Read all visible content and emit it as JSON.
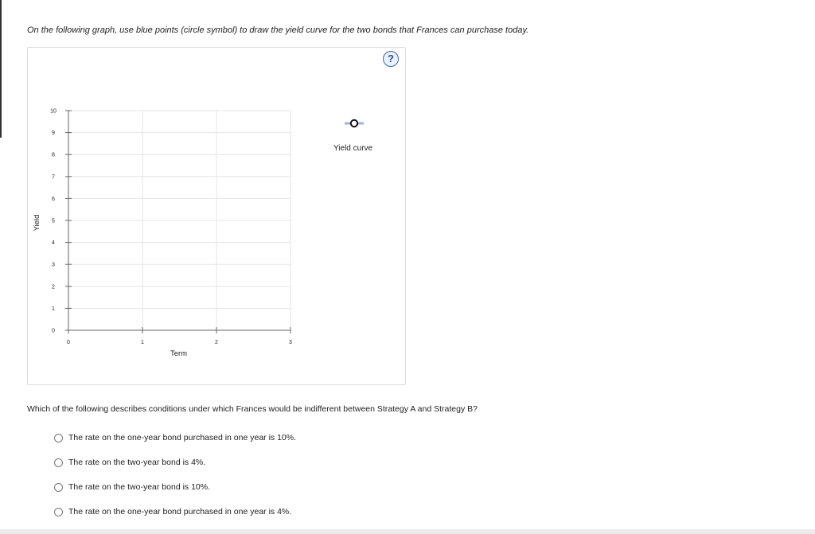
{
  "instruction": "On the following graph, use blue points (circle symbol) to draw the yield curve for the two bonds that Frances can purchase today.",
  "help_symbol": "?",
  "help_icon": "question-circle-icon",
  "legend": {
    "label": "Yield curve",
    "tool_icon": "circle-point-tool-icon"
  },
  "colors": {
    "accent": "#3a67b5",
    "legend_line": "#9db4d6",
    "grid": "#e6e6e6",
    "axis": "#666666"
  },
  "chart_data": {
    "type": "scatter",
    "xlabel": "Term",
    "ylabel": "Yield",
    "xlim": [
      0,
      3
    ],
    "ylim": [
      0,
      10
    ],
    "x_ticks": [
      "0",
      "1",
      "2",
      "3"
    ],
    "y_ticks": [
      "0",
      "1",
      "2",
      "3",
      "4",
      "5",
      "6",
      "7",
      "8",
      "9",
      "10"
    ],
    "grid": true,
    "legend_position": "top-right",
    "series": [
      {
        "name": "Yield curve",
        "x": [],
        "y": []
      }
    ]
  },
  "question": "Which of the following describes conditions under which Frances would be indifferent between Strategy A and Strategy B?",
  "options": [
    {
      "label": "The rate on the one-year bond purchased in one year is 10%."
    },
    {
      "label": "The rate on the two-year bond is 4%."
    },
    {
      "label": "The rate on the two-year bond is 10%."
    },
    {
      "label": "The rate on the one-year bond purchased in one year is 4%."
    }
  ]
}
